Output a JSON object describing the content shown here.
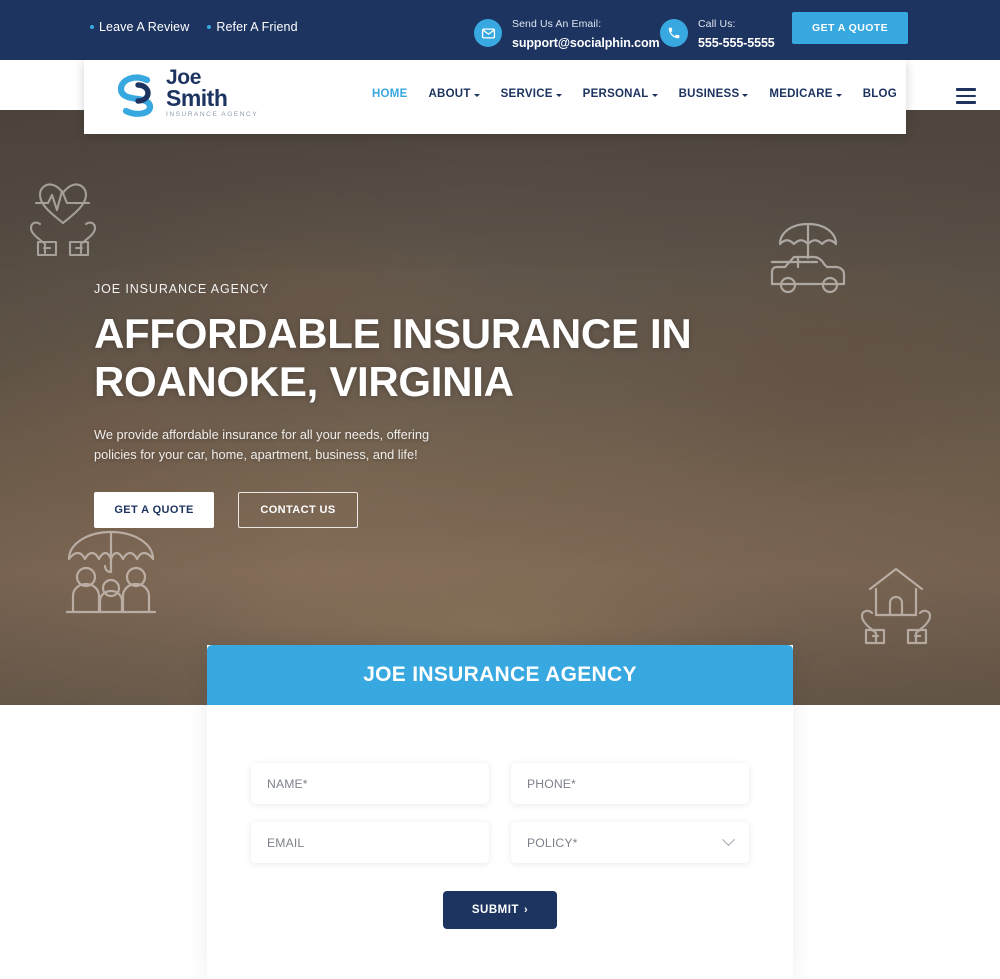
{
  "topbar": {
    "links": [
      {
        "label": "Leave A Review",
        "icon": "bullet-dot-icon"
      },
      {
        "label": "Refer A Friend",
        "icon": "bullet-dot-icon"
      }
    ],
    "email": {
      "label": "Send Us An Email:",
      "value": "support@socialphin.com",
      "icon": "envelope-icon"
    },
    "phone": {
      "label": "Call Us:",
      "value": "555-555-5555",
      "icon": "phone-icon"
    },
    "cta_label": "GET A QUOTE",
    "bg_color": "#1d3461",
    "accent_color": "#38a8e0"
  },
  "header": {
    "logo": {
      "line1": "Joe",
      "line2": "Smith",
      "tagline": "INSURANCE AGENCY"
    },
    "nav": [
      {
        "label": "HOME",
        "has_dropdown": false,
        "active": true
      },
      {
        "label": "ABOUT",
        "has_dropdown": true,
        "active": false
      },
      {
        "label": "SERVICE",
        "has_dropdown": true,
        "active": false
      },
      {
        "label": "PERSONAL",
        "has_dropdown": true,
        "active": false
      },
      {
        "label": "BUSINESS",
        "has_dropdown": true,
        "active": false
      },
      {
        "label": "MEDICARE",
        "has_dropdown": true,
        "active": false
      },
      {
        "label": "BLOG",
        "has_dropdown": false,
        "active": false
      }
    ],
    "menu_icon": "hamburger-menu-icon"
  },
  "hero": {
    "eyebrow": "JOE INSURANCE AGENCY",
    "title_line1": "AFFORDABLE INSURANCE IN",
    "title_line2": "ROANOKE, VIRGINIA",
    "subtitle_line1": "We provide affordable insurance for all your needs, offering policies for",
    "subtitle_line2": "your car, home, apartment, business, and life!",
    "primary_cta": "GET A QUOTE",
    "secondary_cta": "CONTACT US",
    "decorative_icons": [
      "health-heart-hands-icon",
      "car-umbrella-icon",
      "family-umbrella-icon",
      "home-hands-icon"
    ]
  },
  "form": {
    "heading": "JOE INSURANCE AGENCY",
    "fields": [
      {
        "label": "NAME*",
        "type": "text"
      },
      {
        "label": "PHONE*",
        "type": "text"
      },
      {
        "label": "EMAIL",
        "type": "text"
      },
      {
        "label": "POLICY*",
        "type": "select"
      }
    ],
    "submit_label": "SUBMIT",
    "submit_arrow": "›",
    "header_color": "#38a8e0",
    "submit_color": "#1d3461"
  }
}
